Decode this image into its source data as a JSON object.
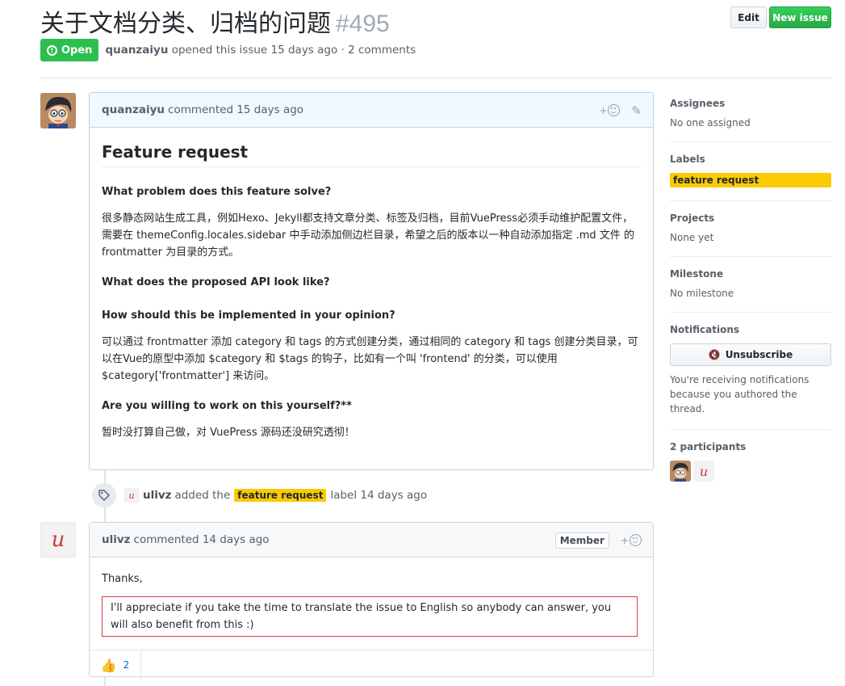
{
  "issue": {
    "title": "关于文档分类、归档的问题",
    "number": "#495",
    "state": "Open",
    "author": "quanzaiyu",
    "meta_text": "opened this issue 15 days ago · 2 comments",
    "edit_label": "Edit",
    "new_issue_label": "New issue"
  },
  "comment1": {
    "author": "quanzaiyu",
    "time": "commented 15 days ago",
    "heading": "Feature request",
    "q1": "What problem does this feature solve?",
    "p1": "很多静态网站生成工具，例如Hexo、Jekyll都支持文章分类、标签及归档，目前VuePress必须手动维护配置文件，需要在 themeConfig.locales.sidebar 中手动添加侧边栏目录，希望之后的版本以一种自动添加指定 .md 文件 的 frontmatter 为目录的方式。",
    "q2": "What does the proposed API look like?",
    "q3": "How should this be implemented in your opinion?",
    "p3": "可以通过 frontmatter 添加 category 和 tags 的方式创建分类，通过相同的 category 和 tags 创建分类目录，可以在Vue的原型中添加 $category 和 $tags 的钩子，比如有一个叫 'frontend' 的分类，可以使用 $category['frontmatter'] 来访问。",
    "q4": "Are you willing to work on this yourself?**",
    "p4": "暂时没打算自己做，对 VuePress 源码还没研究透彻！"
  },
  "event": {
    "actor": "ulivz",
    "action": "added the",
    "label": "feature request",
    "suffix": "label 14 days ago"
  },
  "comment2": {
    "author": "ulivz",
    "time": "commented 14 days ago",
    "role": "Member",
    "p1": "Thanks,",
    "p2": "I'll appreciate if you take the time to translate the issue to English so anybody can answer, you will also benefit from this :)",
    "thumbs_count": "2"
  },
  "sidebar": {
    "assignees_title": "Assignees",
    "assignees_value": "No one assigned",
    "labels_title": "Labels",
    "label": "feature request",
    "projects_title": "Projects",
    "projects_value": "None yet",
    "milestone_title": "Milestone",
    "milestone_value": "No milestone",
    "notifications_title": "Notifications",
    "unsubscribe_label": "Unsubscribe",
    "notifications_note": "You're receiving notifications because you authored the thread.",
    "participants_title": "2 participants"
  },
  "colors": {
    "open_green": "#2cbe4e",
    "label_yellow": "#fbca04",
    "link_blue": "#0366d6",
    "highlight_red": "#d73a49"
  }
}
